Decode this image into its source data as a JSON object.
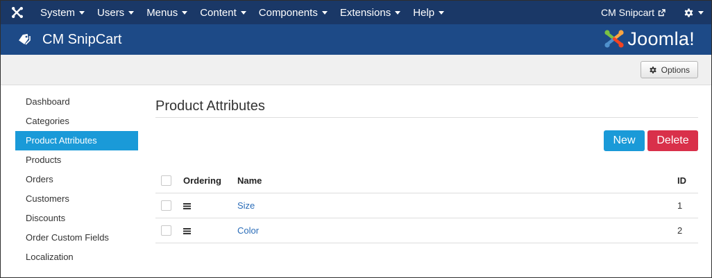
{
  "topnav": {
    "menu": [
      {
        "label": "System"
      },
      {
        "label": "Users"
      },
      {
        "label": "Menus"
      },
      {
        "label": "Content"
      },
      {
        "label": "Components"
      },
      {
        "label": "Extensions"
      },
      {
        "label": "Help"
      }
    ],
    "site_link": "CM Snipcart",
    "site_link_icon": "external-link-icon",
    "settings_icon": "gear-icon"
  },
  "header": {
    "title": "CM SnipCart",
    "icon": "tag-icon",
    "brand": "Joomla!"
  },
  "toolbar": {
    "options_label": "Options"
  },
  "sidebar": {
    "items": [
      {
        "label": "Dashboard"
      },
      {
        "label": "Categories"
      },
      {
        "label": "Product Attributes"
      },
      {
        "label": "Products"
      },
      {
        "label": "Orders"
      },
      {
        "label": "Customers"
      },
      {
        "label": "Discounts"
      },
      {
        "label": "Order Custom Fields"
      },
      {
        "label": "Localization"
      }
    ]
  },
  "main": {
    "page_title": "Product Attributes",
    "new_label": "New",
    "delete_label": "Delete",
    "table": {
      "columns": {
        "ordering": "Ordering",
        "name": "Name",
        "id": "ID"
      },
      "rows": [
        {
          "name": "Size",
          "id": "1"
        },
        {
          "name": "Color",
          "id": "2"
        }
      ]
    }
  },
  "colors": {
    "topbar": "#1a3867",
    "header": "#1d4a87",
    "accent": "#1a9ad8",
    "danger": "#d9304a",
    "link": "#2a6cb8"
  }
}
